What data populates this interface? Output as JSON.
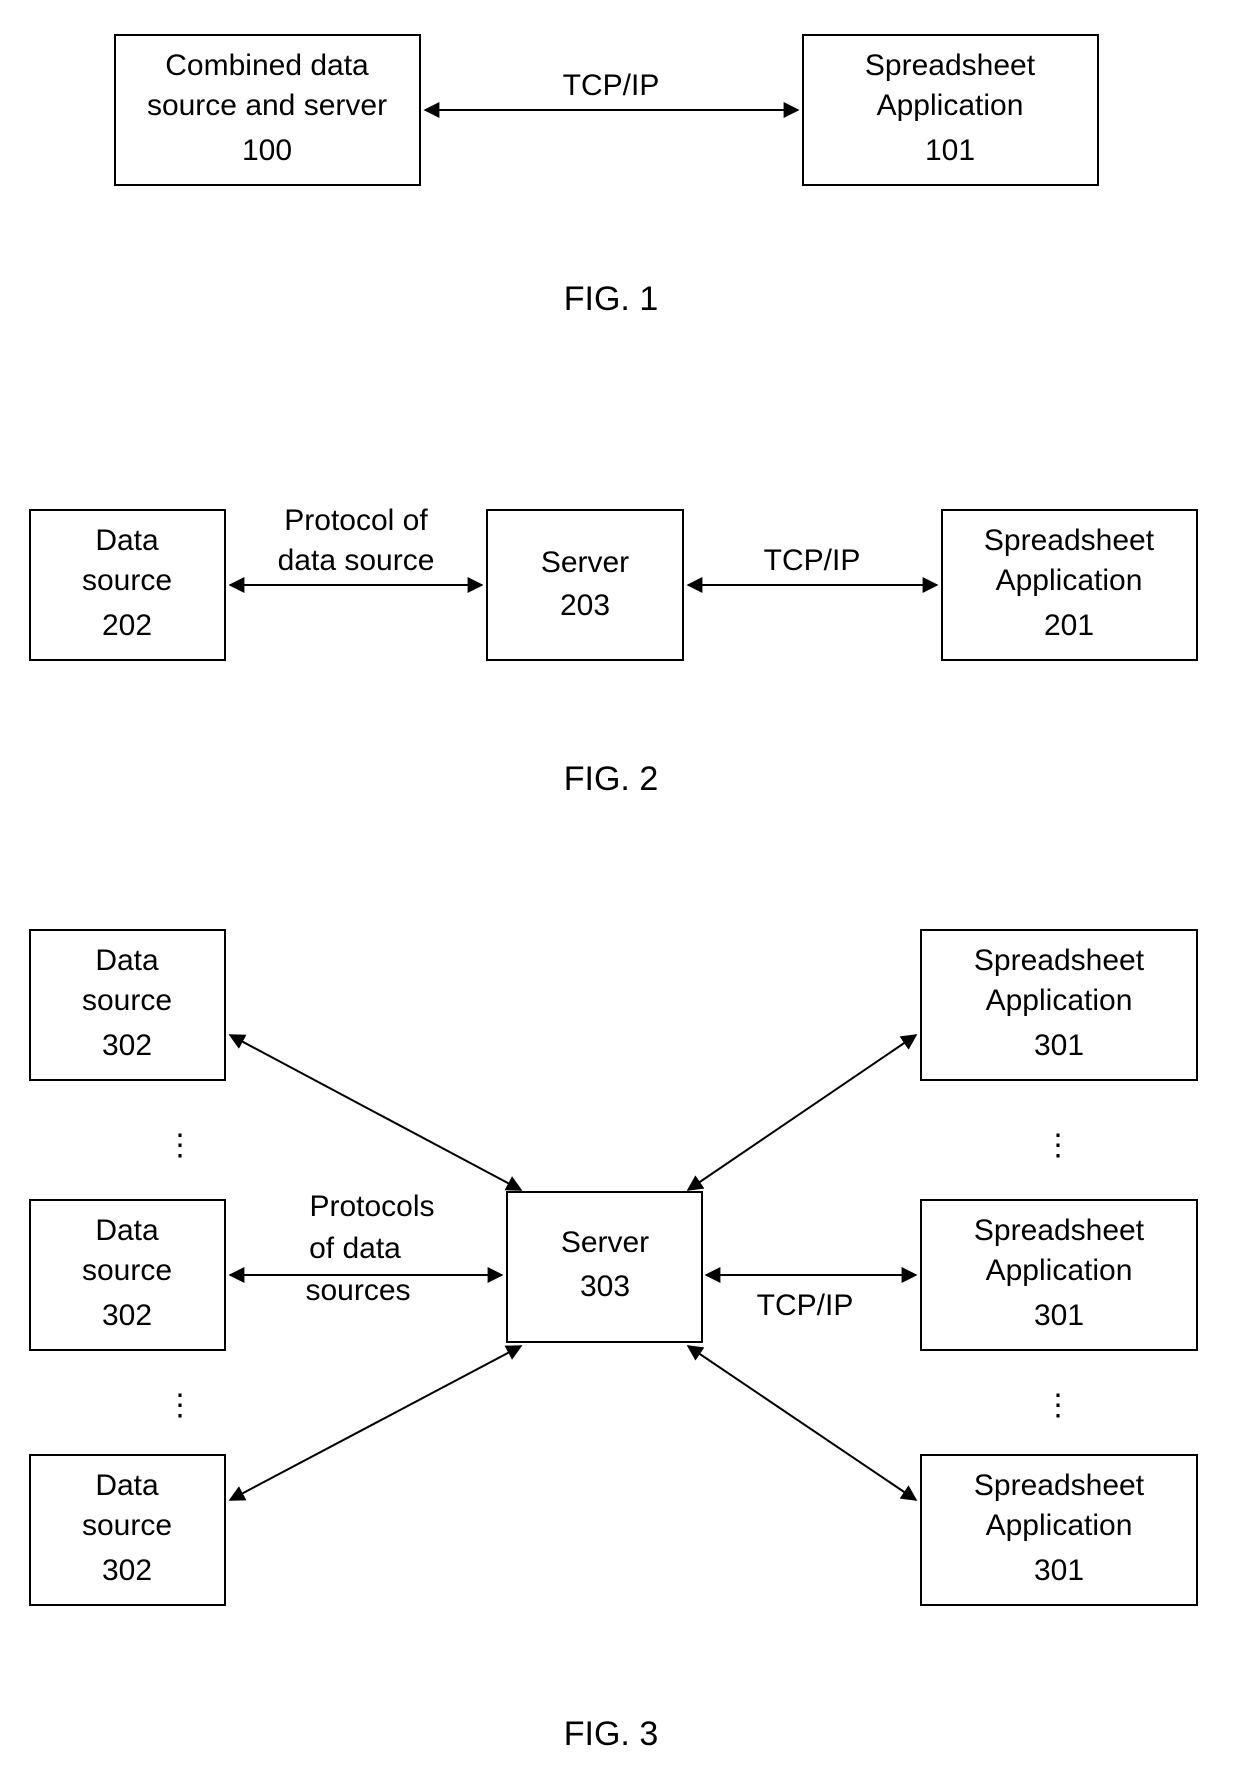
{
  "fig1": {
    "caption": "FIG. 1",
    "box_left": {
      "line1": "Combined data",
      "line2": "source and server",
      "line3": "100"
    },
    "box_right": {
      "line1": "Spreadsheet",
      "line2": "Application",
      "line3": "101"
    },
    "arrow_label": "TCP/IP"
  },
  "fig2": {
    "caption": "FIG. 2",
    "box_left": {
      "line1": "Data",
      "line2": "source",
      "line3": "202"
    },
    "box_mid": {
      "line1": "Server",
      "line2": "203"
    },
    "box_right": {
      "line1": "Spreadsheet",
      "line2": "Application",
      "line3": "201"
    },
    "arrow_left_label1": "Protocol of",
    "arrow_left_label2": "data source",
    "arrow_right_label": "TCP/IP"
  },
  "fig3": {
    "caption": "FIG. 3",
    "data_source_top": {
      "line1": "Data",
      "line2": "source",
      "line3": "302"
    },
    "data_source_mid": {
      "line1": "Data",
      "line2": "source",
      "line3": "302"
    },
    "data_source_bot": {
      "line1": "Data",
      "line2": "source",
      "line3": "302"
    },
    "server": {
      "line1": "Server",
      "line2": "303"
    },
    "app_top": {
      "line1": "Spreadsheet",
      "line2": "Application",
      "line3": "301"
    },
    "app_mid": {
      "line1": "Spreadsheet",
      "line2": "Application",
      "line3": "301"
    },
    "app_bot": {
      "line1": "Spreadsheet",
      "line2": "Application",
      "line3": "301"
    },
    "left_label1": "Protocols",
    "left_label2": "of data",
    "left_label3": "sources",
    "right_label": "TCP/IP",
    "dots": "⋮"
  }
}
